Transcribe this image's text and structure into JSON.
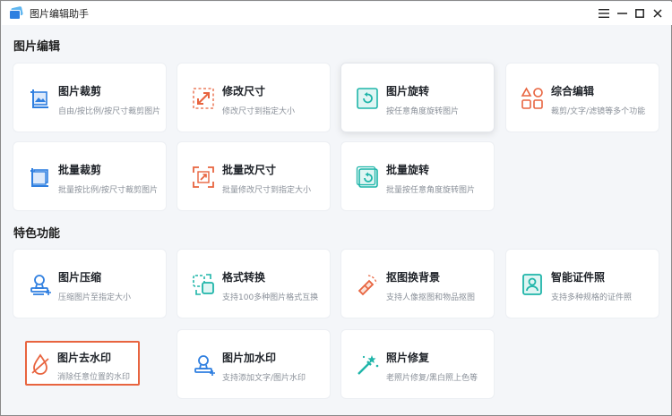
{
  "window": {
    "title": "图片编辑助手",
    "controls": {
      "menu": "≡",
      "minimize": "−",
      "maximize": "□",
      "close": "✕"
    }
  },
  "sections": {
    "edit": {
      "title": "图片编辑"
    },
    "features": {
      "title": "特色功能"
    }
  },
  "cards": {
    "crop": {
      "title": "图片裁剪",
      "desc": "自由/按比例/按尺寸裁剪图片",
      "icon": "crop-icon"
    },
    "resize": {
      "title": "修改尺寸",
      "desc": "修改尺寸到指定大小",
      "icon": "resize-icon"
    },
    "rotate": {
      "title": "图片旋转",
      "desc": "按任意角度旋转图片",
      "icon": "rotate-icon"
    },
    "combo": {
      "title": "综合编辑",
      "desc": "裁剪/文字/滤镜等多个功能",
      "icon": "shapes-icon"
    },
    "batch_crop": {
      "title": "批量裁剪",
      "desc": "批量按比例/按尺寸裁剪图片",
      "icon": "crop-icon"
    },
    "batch_resize": {
      "title": "批量改尺寸",
      "desc": "批量修改尺寸到指定大小",
      "icon": "resize-icon"
    },
    "batch_rotate": {
      "title": "批量旋转",
      "desc": "批量按任意角度旋转图片",
      "icon": "rotate-icon"
    },
    "compress": {
      "title": "图片压缩",
      "desc": "压缩图片至指定大小",
      "icon": "stamp-icon"
    },
    "convert": {
      "title": "格式转换",
      "desc": "支持100多种图片格式互换",
      "icon": "convert-icon"
    },
    "cutout": {
      "title": "抠图换背景",
      "desc": "支持人像抠图和物品抠图",
      "icon": "eraser-icon"
    },
    "idphoto": {
      "title": "智能证件照",
      "desc": "支持多种规格的证件照",
      "icon": "id-photo-icon"
    },
    "dewatermark": {
      "title": "图片去水印",
      "desc": "消除任意位置的水印",
      "icon": "no-water-icon"
    },
    "watermark": {
      "title": "图片加水印",
      "desc": "支持添加文字/图片水印",
      "icon": "stamp-icon"
    },
    "restore": {
      "title": "照片修复",
      "desc": "老照片修复/黑白照上色等",
      "icon": "magic-wand-icon"
    }
  },
  "colors": {
    "blue": "#2f7fe0",
    "orange": "#e8643f",
    "teal": "#1fb5a9",
    "selected_border": "#e8643f"
  }
}
